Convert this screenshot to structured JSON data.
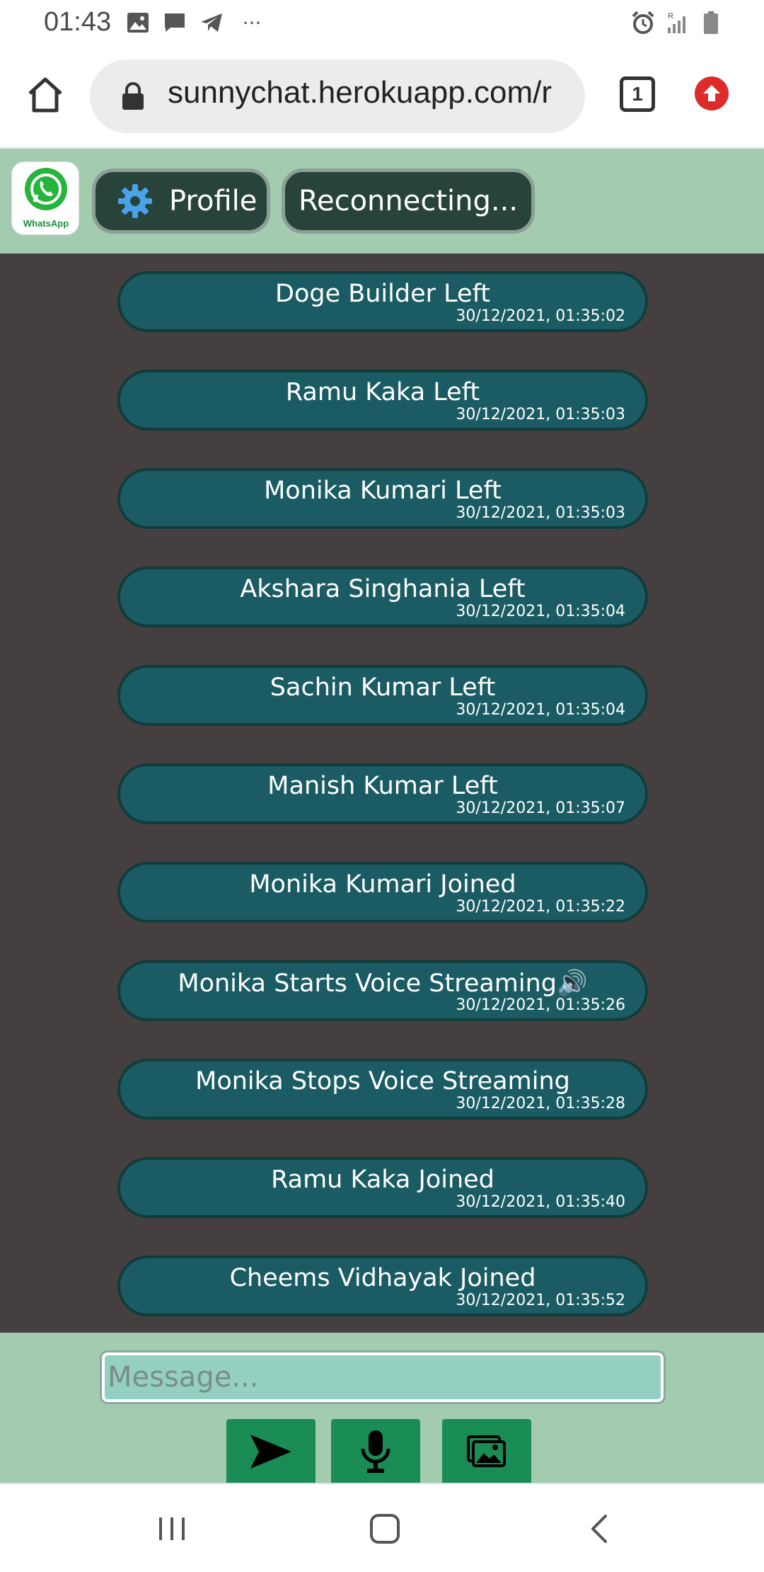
{
  "status_bar": {
    "time": "01:43",
    "left_icons": [
      "image-icon",
      "message-icon",
      "telegram-icon",
      "more-icon"
    ],
    "right_icons": [
      "alarm-icon",
      "signal-icon",
      "battery-icon"
    ],
    "more_glyph": "···"
  },
  "browser": {
    "url": "sunnychat.herokuapp.com/r",
    "tab_count": "1"
  },
  "header": {
    "logo_label": "WhatsApp",
    "profile_label": "Profile",
    "connection_status": "Reconnecting..."
  },
  "messages": [
    {
      "text": "Doge Builder Left",
      "time": "30/12/2021, 01:35:02"
    },
    {
      "text": "Ramu Kaka Left",
      "time": "30/12/2021, 01:35:03"
    },
    {
      "text": "Monika Kumari Left",
      "time": "30/12/2021, 01:35:03"
    },
    {
      "text": "Akshara Singhania Left",
      "time": "30/12/2021, 01:35:04"
    },
    {
      "text": "Sachin Kumar Left",
      "time": "30/12/2021, 01:35:04"
    },
    {
      "text": "Manish Kumar Left",
      "time": "30/12/2021, 01:35:07"
    },
    {
      "text": "Monika Kumari Joined",
      "time": "30/12/2021, 01:35:22"
    },
    {
      "text": "Monika Starts Voice Streaming🔊",
      "time": "30/12/2021, 01:35:26"
    },
    {
      "text": "Monika Stops Voice Streaming",
      "time": "30/12/2021, 01:35:28"
    },
    {
      "text": "Ramu Kaka Joined",
      "time": "30/12/2021, 01:35:40"
    },
    {
      "text": "Cheems Vidhayak Joined",
      "time": "30/12/2021, 01:35:52"
    }
  ],
  "composer": {
    "placeholder": "Message...",
    "value": ""
  },
  "colors": {
    "header_bg": "#a3cbb0",
    "chat_bg": "#463f3f",
    "bubble_bg": "#1b5c64",
    "action_btn": "#1a8c55"
  }
}
